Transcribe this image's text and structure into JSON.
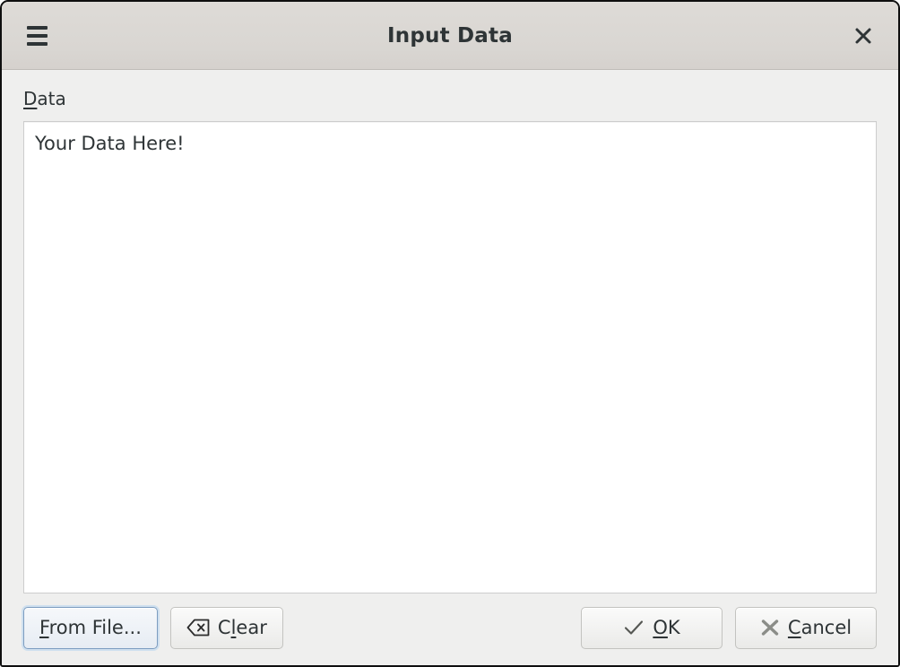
{
  "window": {
    "title": "Input Data",
    "menu_icon": "hamburger-menu-icon",
    "close_icon": "close-icon",
    "frame_color": "#0f0f0f",
    "titlebar_color": "#d9d6d2",
    "body_color": "#efefee"
  },
  "form": {
    "label_prefix": "D",
    "label_rest": "ata",
    "label_full": "Data",
    "textarea_value": "Your Data Here!",
    "textarea_background": "#ffffff",
    "textarea_border": "#cdcdcd"
  },
  "buttons": {
    "from_file": {
      "mnemonic": "F",
      "rest": "rom File...",
      "full": "From File...",
      "focused": true
    },
    "clear": {
      "prefix": "C",
      "mnemonic": "l",
      "rest": "ear",
      "full": "Clear",
      "icon": "backspace-icon"
    },
    "ok": {
      "mnemonic": "O",
      "rest": "K",
      "full": "OK",
      "icon": "check-icon"
    },
    "cancel": {
      "mnemonic": "C",
      "rest": "ancel",
      "full": "Cancel",
      "icon": "cross-icon"
    }
  },
  "colors": {
    "text": "#2e3436",
    "focus_ring": "#7c9cc0",
    "icon_gray": "#888a85"
  }
}
